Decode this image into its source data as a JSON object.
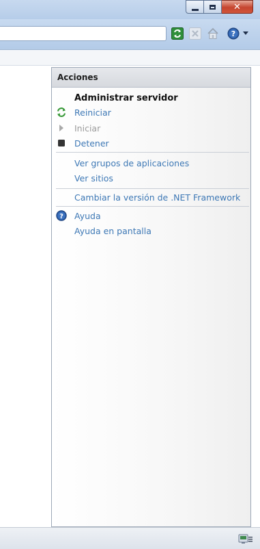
{
  "window": {
    "close_glyph": "✕"
  },
  "toolbar": {
    "refresh_icon": "refresh-icon",
    "stop_icon": "stop-icon",
    "home_icon": "home-icon",
    "help_icon": "help-icon",
    "help_dropdown_icon": "chevron-down-icon"
  },
  "actions_pane": {
    "title": "Acciones",
    "section_title": "Administrar servidor",
    "items": [
      {
        "label": "Reiniciar",
        "icon": "restart-icon",
        "enabled": true
      },
      {
        "label": "Iniciar",
        "icon": "play-icon",
        "enabled": false
      },
      {
        "label": "Detener",
        "icon": "stop-square-icon",
        "enabled": true
      },
      {
        "label": "Ver grupos de aplicaciones",
        "icon": null,
        "enabled": true
      },
      {
        "label": "Ver sitios",
        "icon": null,
        "enabled": true
      },
      {
        "label": "Cambiar la versión de .NET Framework",
        "icon": null,
        "enabled": true
      },
      {
        "label": "Ayuda",
        "icon": "help-icon",
        "enabled": true
      },
      {
        "label": "Ayuda en pantalla",
        "icon": null,
        "enabled": true
      }
    ]
  },
  "colors": {
    "link": "#3d78b5",
    "disabled": "#9a9a9a",
    "header_bg": "#dcdfe4"
  }
}
